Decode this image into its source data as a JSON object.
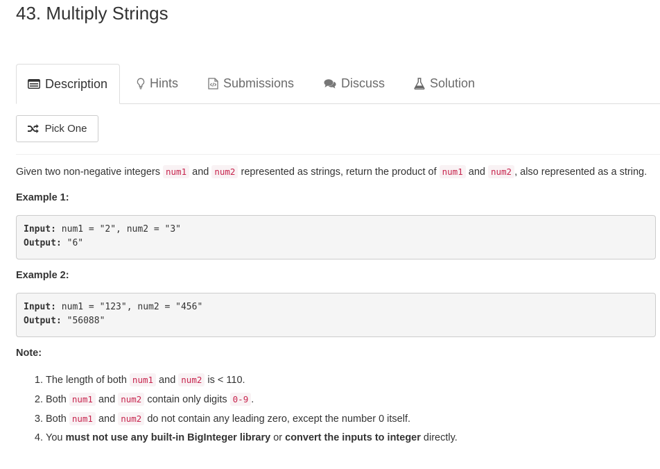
{
  "problem": {
    "title": "43. Multiply Strings"
  },
  "tabs": [
    {
      "label": "Description",
      "icon": "list-alt-icon",
      "active": true
    },
    {
      "label": "Hints",
      "icon": "lightbulb-icon",
      "active": false
    },
    {
      "label": "Submissions",
      "icon": "file-code-icon",
      "active": false
    },
    {
      "label": "Discuss",
      "icon": "comments-icon",
      "active": false
    },
    {
      "label": "Solution",
      "icon": "flask-icon",
      "active": false
    }
  ],
  "pick_one": {
    "label": "Pick One",
    "icon": "random-icon"
  },
  "description": {
    "intro_1": "Given two non-negative integers ",
    "code_num1": "num1",
    "and": " and ",
    "code_num2": "num2",
    "intro_2": " represented as strings, return the product of ",
    "intro_3": ", also represented as a string."
  },
  "examples": [
    {
      "heading": "Example 1:",
      "input_label": "Input:",
      "input_value": " num1 = \"2\", num2 = \"3\"",
      "output_label": "Output:",
      "output_value": " \"6\""
    },
    {
      "heading": "Example 2:",
      "input_label": "Input:",
      "input_value": " num1 = \"123\", num2 = \"456\"",
      "output_label": "Output:",
      "output_value": " \"56088\""
    }
  ],
  "note": {
    "heading": "Note:",
    "item1_a": "The length of both ",
    "item1_b": " is < 110.",
    "item2_a": "Both ",
    "item2_b": " contain only digits ",
    "item2_code": "0-9",
    "item2_c": ".",
    "item3_b": " do not contain any leading zero, except the number 0 itself.",
    "item4_a": "You ",
    "item4_bold1": "must not use any built-in BigInteger library",
    "item4_b": " or ",
    "item4_bold2": "convert the inputs to integer",
    "item4_c": " directly."
  },
  "colors": {
    "code_text": "#c7254e",
    "code_bg": "#f9f2f4",
    "pre_bg": "#f5f5f5",
    "border": "#dddddd"
  }
}
